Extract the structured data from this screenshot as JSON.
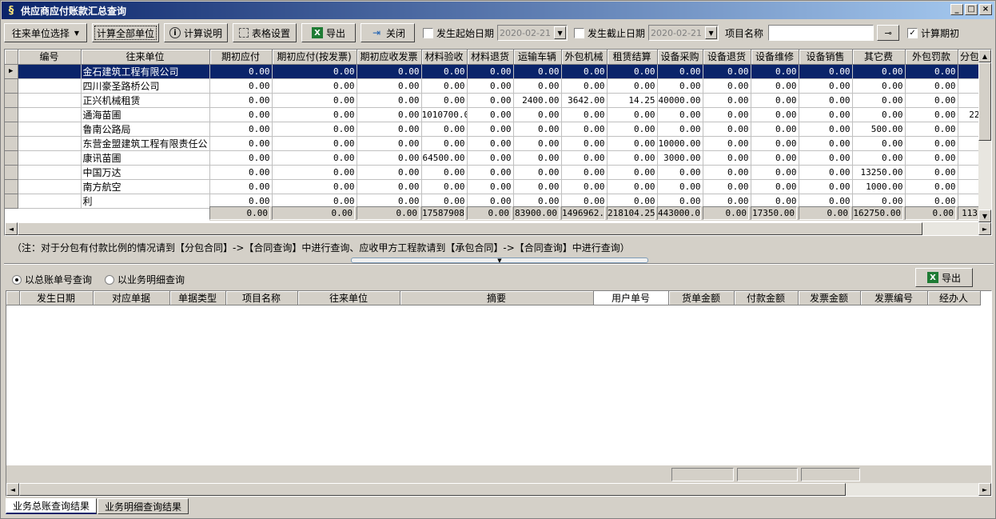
{
  "window": {
    "title": "供应商应付账款汇总查询"
  },
  "toolbar": {
    "partner_select": "往来单位选择",
    "calc_all": "计算全部单位",
    "calc_desc": "计算说明",
    "table_settings": "表格设置",
    "export": "导出",
    "close": "关闭",
    "start_date_label": "发生起始日期",
    "start_date_value": "2020-02-21",
    "end_date_label": "发生截止日期",
    "end_date_value": "2020-02-21",
    "project_label": "项目名称",
    "project_value": "",
    "calc_period_label": "计算期初"
  },
  "grid1": {
    "columns": [
      "编号",
      "往来单位",
      "期初应付",
      "期初应付(按发票)",
      "期初应收发票",
      "材料验收",
      "材料退货",
      "运输车辆",
      "外包机械",
      "租赁结算",
      "设备采购",
      "设备退货",
      "设备维修",
      "设备销售",
      "其它费",
      "外包罚款",
      "分包"
    ],
    "rows": [
      [
        "",
        "金石建筑工程有限公司",
        "0.00",
        "0.00",
        "0.00",
        "0.00",
        "0.00",
        "0.00",
        "0.00",
        "0.00",
        "0.00",
        "0.00",
        "0.00",
        "0.00",
        "0.00",
        "0.00",
        ""
      ],
      [
        "",
        "四川豪圣路桥公司",
        "0.00",
        "0.00",
        "0.00",
        "0.00",
        "0.00",
        "0.00",
        "0.00",
        "0.00",
        "0.00",
        "0.00",
        "0.00",
        "0.00",
        "0.00",
        "0.00",
        ""
      ],
      [
        "",
        "正兴机械租赁",
        "0.00",
        "0.00",
        "0.00",
        "0.00",
        "0.00",
        "2400.00",
        "3642.00",
        "14.25",
        "40000.00",
        "0.00",
        "0.00",
        "0.00",
        "0.00",
        "0.00",
        ""
      ],
      [
        "",
        "通海苗圃",
        "0.00",
        "0.00",
        "0.00",
        "1010700.0",
        "0.00",
        "0.00",
        "0.00",
        "0.00",
        "0.00",
        "0.00",
        "0.00",
        "0.00",
        "0.00",
        "0.00",
        "22"
      ],
      [
        "",
        "鲁南公路局",
        "0.00",
        "0.00",
        "0.00",
        "0.00",
        "0.00",
        "0.00",
        "0.00",
        "0.00",
        "0.00",
        "0.00",
        "0.00",
        "0.00",
        "500.00",
        "0.00",
        ""
      ],
      [
        "",
        "东营金盟建筑工程有限责任公",
        "0.00",
        "0.00",
        "0.00",
        "0.00",
        "0.00",
        "0.00",
        "0.00",
        "0.00",
        "10000.00",
        "0.00",
        "0.00",
        "0.00",
        "0.00",
        "0.00",
        ""
      ],
      [
        "",
        "康讯苗圃",
        "0.00",
        "0.00",
        "0.00",
        "64500.00",
        "0.00",
        "0.00",
        "0.00",
        "0.00",
        "3000.00",
        "0.00",
        "0.00",
        "0.00",
        "0.00",
        "0.00",
        ""
      ],
      [
        "",
        "中国万达",
        "0.00",
        "0.00",
        "0.00",
        "0.00",
        "0.00",
        "0.00",
        "0.00",
        "0.00",
        "0.00",
        "0.00",
        "0.00",
        "0.00",
        "13250.00",
        "0.00",
        ""
      ],
      [
        "",
        "南方航空",
        "0.00",
        "0.00",
        "0.00",
        "0.00",
        "0.00",
        "0.00",
        "0.00",
        "0.00",
        "0.00",
        "0.00",
        "0.00",
        "0.00",
        "1000.00",
        "0.00",
        ""
      ],
      [
        "",
        "利",
        "0.00",
        "0.00",
        "0.00",
        "0.00",
        "0.00",
        "0.00",
        "0.00",
        "0.00",
        "0.00",
        "0.00",
        "0.00",
        "0.00",
        "0.00",
        "0.00",
        ""
      ]
    ],
    "totals": [
      "0.00",
      "0.00",
      "0.00",
      "17587908",
      "0.00",
      "83900.00",
      "1496962.",
      "218104.25",
      "443000.00",
      "0.00",
      "17350.00",
      "0.00",
      "162750.00",
      "0.00",
      "113"
    ]
  },
  "note": "（注：对于分包有付款比例的情况请到【分包合同】->【合同查询】中进行查询、应收甲方工程款请到【承包合同】->【合同查询】中进行查询）",
  "query_mode": {
    "by_ledger": "以总账单号查询",
    "by_detail": "以业务明细查询"
  },
  "export2": "导出",
  "grid2": {
    "columns": [
      "发生日期",
      "对应单据",
      "单据类型",
      "项目名称",
      "往来单位",
      "摘要",
      "用户单号",
      "货单金额",
      "付款金额",
      "发票金额",
      "发票编号",
      "经办人"
    ]
  },
  "tabs": [
    "业务总账查询结果",
    "业务明细查询结果"
  ]
}
